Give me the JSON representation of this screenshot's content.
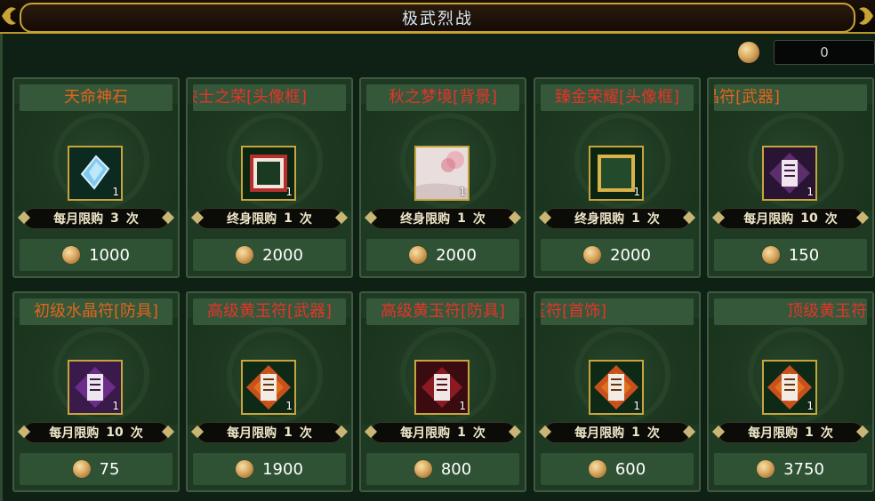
{
  "window": {
    "title": "极武烈战"
  },
  "currency": {
    "value": "0",
    "icon": "gold-coin-icon"
  },
  "items": [
    {
      "name": "天命神石",
      "count": "1",
      "limit_label": "每月限购",
      "limit_num": "3",
      "limit_unit": "次",
      "price": "1000",
      "icon": "blue-gem-icon",
      "title_color": "orange"
    },
    {
      "name": "侠士之荣[头像框]",
      "count": "1",
      "limit_label": "终身限购",
      "limit_num": "1",
      "limit_unit": "次",
      "price": "2000",
      "icon": "red-frame-icon",
      "title_color": "red"
    },
    {
      "name": "秋之梦境[背景]",
      "count": "1",
      "limit_label": "终身限购",
      "limit_num": "1",
      "limit_unit": "次",
      "price": "2000",
      "icon": "autumn-scene-icon",
      "title_color": "red"
    },
    {
      "name": "臻金荣耀[头像框]",
      "count": "1",
      "limit_label": "终身限购",
      "limit_num": "1",
      "limit_unit": "次",
      "price": "2000",
      "icon": "gold-frame-icon",
      "title_color": "red"
    },
    {
      "name": "晶符[武器]",
      "count": "1",
      "limit_label": "每月限购",
      "limit_num": "10",
      "limit_unit": "次",
      "price": "150",
      "icon": "crystal-talisman-icon",
      "title_color": "orange"
    },
    {
      "name": "初级水晶符[防具]",
      "count": "1",
      "limit_label": "每月限购",
      "limit_num": "10",
      "limit_unit": "次",
      "price": "75",
      "icon": "purple-talisman-icon",
      "title_color": "orange"
    },
    {
      "name": "高级黄玉符[武器]",
      "count": "1",
      "limit_label": "每月限购",
      "limit_num": "1",
      "limit_unit": "次",
      "price": "1900",
      "icon": "jade-talisman-icon",
      "title_color": "red"
    },
    {
      "name": "高级黄玉符[防具]",
      "count": "1",
      "limit_label": "每月限购",
      "limit_num": "1",
      "limit_unit": "次",
      "price": "800",
      "icon": "red-talisman-icon",
      "title_color": "red"
    },
    {
      "name": "玉符[首饰]",
      "count": "1",
      "limit_label": "每月限购",
      "limit_num": "1",
      "limit_unit": "次",
      "price": "600",
      "icon": "jade-talisman-icon",
      "title_color": "red"
    },
    {
      "name": "顶级黄玉符",
      "count": "1",
      "limit_label": "每月限购",
      "limit_num": "1",
      "limit_unit": "次",
      "price": "3750",
      "icon": "jade-talisman-icon",
      "title_color": "red"
    }
  ],
  "colors": {
    "accent_gold": "#c9a335",
    "title_orange": "#e2641c",
    "title_red": "#e5342a",
    "card_green": "#1e3a22"
  }
}
